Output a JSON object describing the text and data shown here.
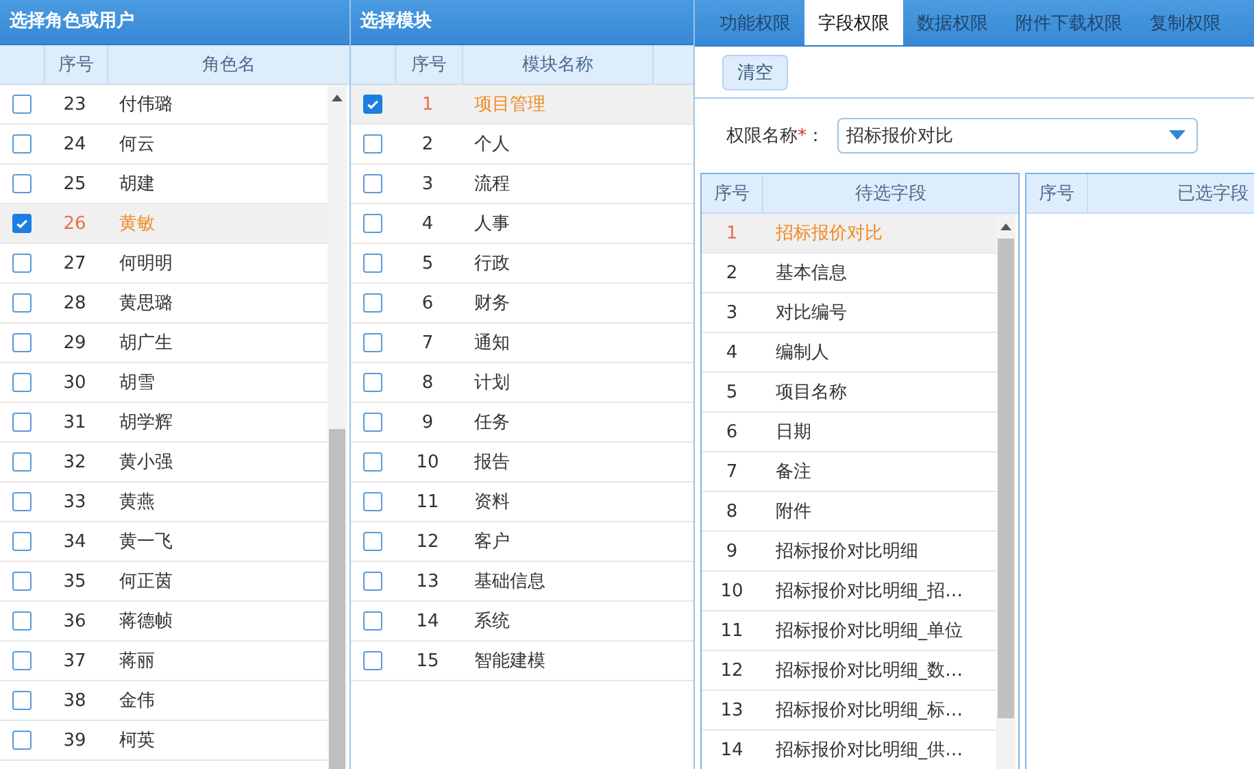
{
  "roles_panel": {
    "title": "选择角色或用户",
    "columns": [
      "序号",
      "角色名"
    ],
    "rows": [
      {
        "no": "23",
        "name": "付伟璐",
        "checked": false,
        "selected": false
      },
      {
        "no": "24",
        "name": "何云",
        "checked": false,
        "selected": false
      },
      {
        "no": "25",
        "name": "胡建",
        "checked": false,
        "selected": false
      },
      {
        "no": "26",
        "name": "黄敏",
        "checked": true,
        "selected": true
      },
      {
        "no": "27",
        "name": "何明明",
        "checked": false,
        "selected": false
      },
      {
        "no": "28",
        "name": "黄思璐",
        "checked": false,
        "selected": false
      },
      {
        "no": "29",
        "name": "胡广生",
        "checked": false,
        "selected": false
      },
      {
        "no": "30",
        "name": "胡雪",
        "checked": false,
        "selected": false
      },
      {
        "no": "31",
        "name": "胡学辉",
        "checked": false,
        "selected": false
      },
      {
        "no": "32",
        "name": "黄小强",
        "checked": false,
        "selected": false
      },
      {
        "no": "33",
        "name": "黄燕",
        "checked": false,
        "selected": false
      },
      {
        "no": "34",
        "name": "黄一飞",
        "checked": false,
        "selected": false
      },
      {
        "no": "35",
        "name": "何正茵",
        "checked": false,
        "selected": false
      },
      {
        "no": "36",
        "name": "蒋德帧",
        "checked": false,
        "selected": false
      },
      {
        "no": "37",
        "name": "蒋丽",
        "checked": false,
        "selected": false
      },
      {
        "no": "38",
        "name": "金伟",
        "checked": false,
        "selected": false
      },
      {
        "no": "39",
        "name": "柯英",
        "checked": false,
        "selected": false
      }
    ]
  },
  "modules_panel": {
    "title": "选择模块",
    "columns": [
      "序号",
      "模块名称"
    ],
    "rows": [
      {
        "no": "1",
        "name": "项目管理",
        "checked": true,
        "selected": true
      },
      {
        "no": "2",
        "name": "个人",
        "checked": false,
        "selected": false
      },
      {
        "no": "3",
        "name": "流程",
        "checked": false,
        "selected": false
      },
      {
        "no": "4",
        "name": "人事",
        "checked": false,
        "selected": false
      },
      {
        "no": "5",
        "name": "行政",
        "checked": false,
        "selected": false
      },
      {
        "no": "6",
        "name": "财务",
        "checked": false,
        "selected": false
      },
      {
        "no": "7",
        "name": "通知",
        "checked": false,
        "selected": false
      },
      {
        "no": "8",
        "name": "计划",
        "checked": false,
        "selected": false
      },
      {
        "no": "9",
        "name": "任务",
        "checked": false,
        "selected": false
      },
      {
        "no": "10",
        "name": "报告",
        "checked": false,
        "selected": false
      },
      {
        "no": "11",
        "name": "资料",
        "checked": false,
        "selected": false
      },
      {
        "no": "12",
        "name": "客户",
        "checked": false,
        "selected": false
      },
      {
        "no": "13",
        "name": "基础信息",
        "checked": false,
        "selected": false
      },
      {
        "no": "14",
        "name": "系统",
        "checked": false,
        "selected": false
      },
      {
        "no": "15",
        "name": "智能建模",
        "checked": false,
        "selected": false
      }
    ]
  },
  "tabs": [
    {
      "label": "功能权限",
      "selected": false
    },
    {
      "label": "字段权限",
      "selected": true
    },
    {
      "label": "数据权限",
      "selected": false
    },
    {
      "label": "附件下载权限",
      "selected": false
    },
    {
      "label": "复制权限",
      "selected": false
    }
  ],
  "toolbar": {
    "clear_button": "清空"
  },
  "permission_name": {
    "label": "权限名称",
    "required_mark": "*",
    "colon": "：",
    "value": "招标报价对比"
  },
  "available_fields": {
    "columns": [
      "序号",
      "待选字段"
    ],
    "rows": [
      {
        "no": "1",
        "name": "招标报价对比",
        "selected": true
      },
      {
        "no": "2",
        "name": "基本信息",
        "selected": false
      },
      {
        "no": "3",
        "name": "对比编号",
        "selected": false
      },
      {
        "no": "4",
        "name": "编制人",
        "selected": false
      },
      {
        "no": "5",
        "name": "项目名称",
        "selected": false
      },
      {
        "no": "6",
        "name": "日期",
        "selected": false
      },
      {
        "no": "7",
        "name": "备注",
        "selected": false
      },
      {
        "no": "8",
        "name": "附件",
        "selected": false
      },
      {
        "no": "9",
        "name": "招标报价对比明细",
        "selected": false
      },
      {
        "no": "10",
        "name": "招标报价对比明细_招…",
        "selected": false
      },
      {
        "no": "11",
        "name": "招标报价对比明细_单位",
        "selected": false
      },
      {
        "no": "12",
        "name": "招标报价对比明细_数…",
        "selected": false
      },
      {
        "no": "13",
        "name": "招标报价对比明细_标…",
        "selected": false
      },
      {
        "no": "14",
        "name": "招标报价对比明细_供…",
        "selected": false
      }
    ]
  },
  "selected_fields": {
    "columns": [
      "序号",
      "已选字段"
    ]
  }
}
